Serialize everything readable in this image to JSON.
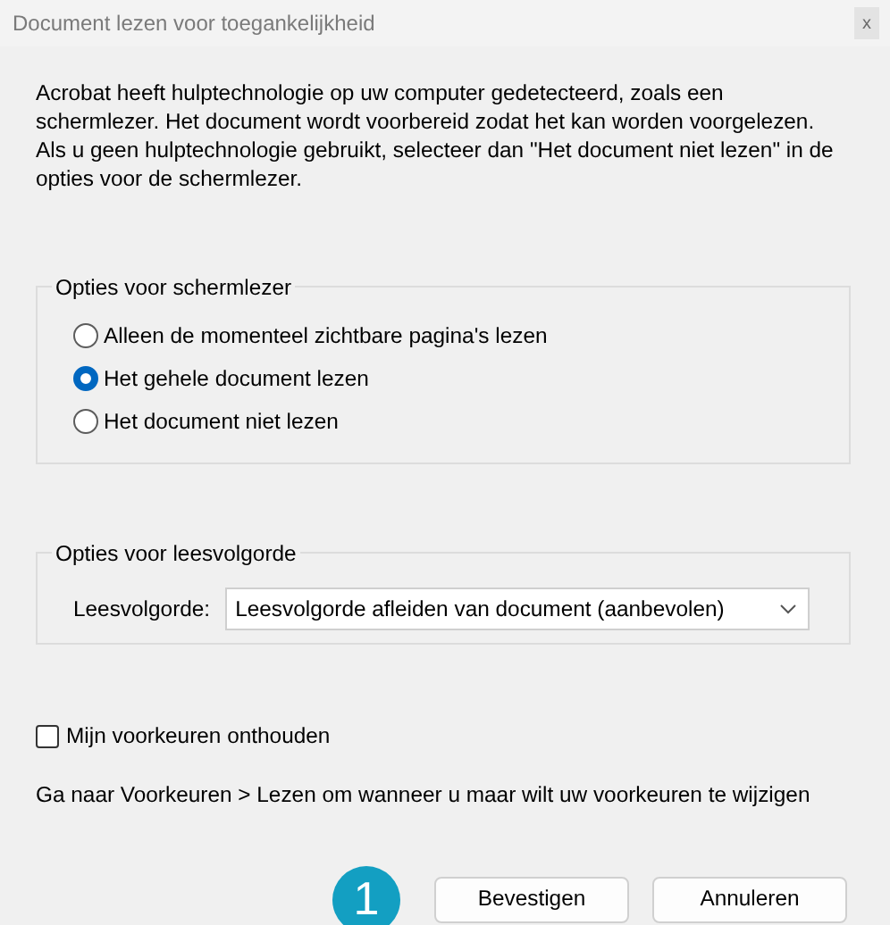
{
  "window": {
    "title": "Document lezen voor toegankelijkheid",
    "close": "x"
  },
  "intro": "Acrobat heeft hulptechnologie op uw computer gedetecteerd, zoals een schermlezer. Het document wordt voorbereid zodat het kan worden voorgelezen. Als u geen hulptechnologie gebruikt, selecteer dan \"Het document niet lezen\" in de opties voor de schermlezer.",
  "screen_reader_group": {
    "title": "Opties voor schermlezer",
    "options": [
      {
        "label": "Alleen de momenteel zichtbare pagina's lezen",
        "selected": false
      },
      {
        "label": "Het gehele document lezen",
        "selected": true
      },
      {
        "label": "Het document niet lezen",
        "selected": false
      }
    ]
  },
  "reading_order_group": {
    "title": "Opties voor leesvolgorde",
    "label": "Leesvolgorde:",
    "value": "Leesvolgorde afleiden van document (aanbevolen)"
  },
  "remember": {
    "label": "Mijn voorkeuren onthouden",
    "checked": false
  },
  "hint": "Ga naar Voorkeuren > Lezen om wanneer u maar wilt uw voorkeuren te wijzigen",
  "callout": "1",
  "buttons": [
    "Bevestigen",
    "Annuleren"
  ]
}
